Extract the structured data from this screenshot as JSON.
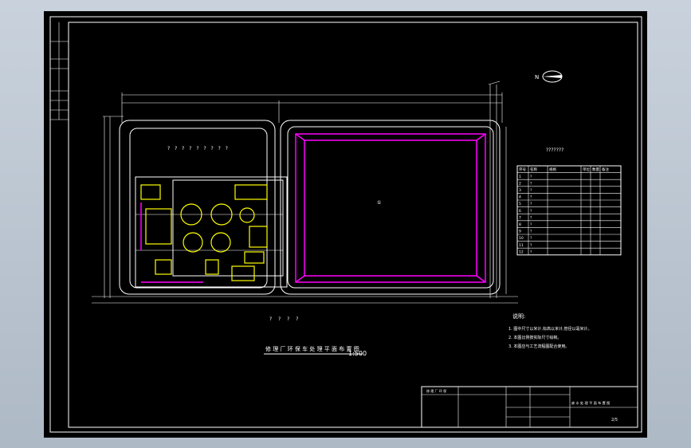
{
  "drawing": {
    "title": "修 理 厂 环 保 车 处 理 平 面 布 置 图",
    "scale": "1:500",
    "north_label": "N",
    "north_icon": "north-arrow-icon",
    "upper_area_label": "? ? ? ? ? ? ? ? ?",
    "bottom_label": "? ? ? ?",
    "main_pond_label": "①",
    "table_title": "???????",
    "notes_title": "说明:",
    "notes": [
      "1. 图中尺寸以米计,标高以米计,管径以毫米计。",
      "2. 本图比例按实际尺寸绘制。",
      "3. 本图应与工艺流程图配合使用。"
    ],
    "table_header": [
      "序号",
      "名称",
      "规格",
      "单位",
      "数量",
      "备注"
    ],
    "table_rows": [
      [
        "1",
        "?",
        "",
        "",
        "",
        ""
      ],
      [
        "2",
        "?",
        "",
        "",
        "",
        ""
      ],
      [
        "3",
        "?",
        "",
        "",
        "",
        ""
      ],
      [
        "4",
        "?",
        "",
        "",
        "",
        ""
      ],
      [
        "5",
        "?",
        "",
        "",
        "",
        ""
      ],
      [
        "6",
        "?",
        "",
        "",
        "",
        ""
      ],
      [
        "7",
        "?",
        "",
        "",
        "",
        ""
      ],
      [
        "8",
        "?",
        "",
        "",
        "",
        ""
      ],
      [
        "9",
        "?",
        "",
        "",
        "",
        ""
      ],
      [
        "10",
        "?",
        "",
        "",
        "",
        ""
      ],
      [
        "11",
        "?",
        "",
        "",
        "",
        ""
      ],
      [
        "12",
        "?",
        "",
        "",
        "",
        ""
      ]
    ],
    "title_block": {
      "cell_a": "修 理 厂 环 保",
      "cell_b": "废 水 处 理 平 面 布 置 图",
      "sheet": "2/5"
    }
  }
}
